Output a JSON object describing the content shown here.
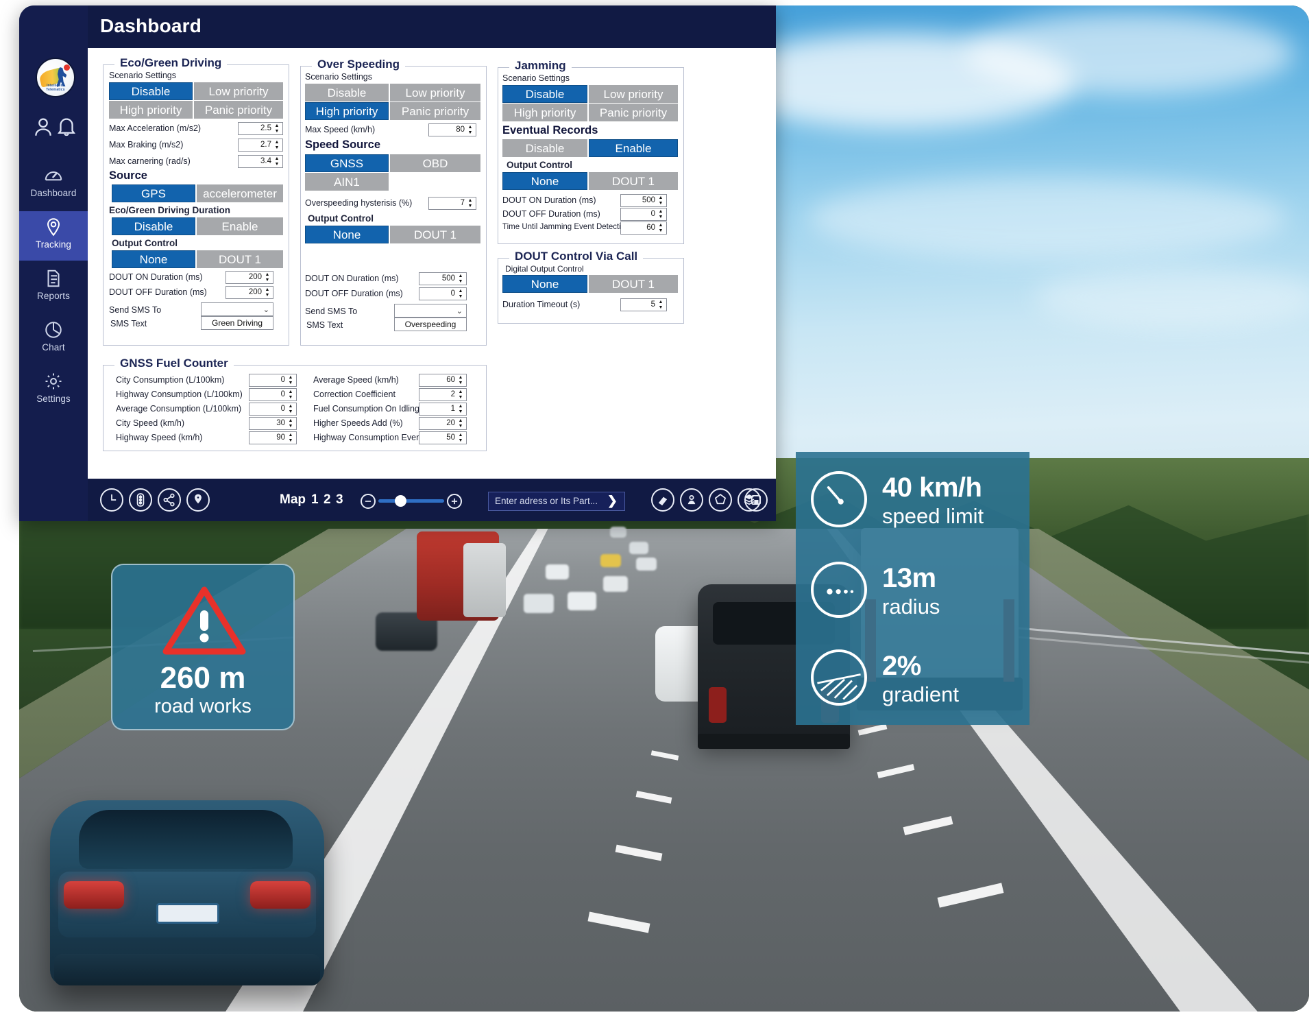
{
  "window": {
    "title": "Dashboard"
  },
  "sidebar": {
    "logo_text": "Intelligent Telematics",
    "top_icons": [
      {
        "name": "user-icon",
        "glyph": "user"
      },
      {
        "name": "bell-icon",
        "glyph": "bell"
      }
    ],
    "items": [
      {
        "label": "Dashboard",
        "icon": "gauge-icon",
        "active": false
      },
      {
        "label": "Tracking",
        "icon": "map-pin-icon",
        "active": true
      },
      {
        "label": "Reports",
        "icon": "document-icon",
        "active": false
      },
      {
        "label": "Chart",
        "icon": "pie-chart-icon",
        "active": false
      },
      {
        "label": "Settings",
        "icon": "gear-icon",
        "active": false
      }
    ]
  },
  "eco": {
    "legend": "Eco/Green Driving",
    "scenario_label": "Scenario Settings",
    "scenario_options": [
      "Disable",
      "Low priority",
      "High priority",
      "Panic priority"
    ],
    "scenario_selected": "Disable",
    "fields": [
      {
        "label": "Max Acceleration (m/s2)",
        "value": "2.5"
      },
      {
        "label": "Max Braking (m/s2)",
        "value": "2.7"
      },
      {
        "label": "Max carnering (rad/s)",
        "value": "3.4"
      }
    ],
    "source_label": "Source",
    "source_options": [
      "GPS",
      "accelerometer"
    ],
    "source_selected": "GPS",
    "duration_label": "Eco/Green Driving Duration",
    "duration_options": [
      "Disable",
      "Enable"
    ],
    "duration_selected": "Disable",
    "output_label": "Output Control",
    "output_options": [
      "None",
      "DOUT 1"
    ],
    "output_selected": "None",
    "dout_fields": [
      {
        "label": "DOUT ON Duration (ms)",
        "value": "200"
      },
      {
        "label": "DOUT OFF Duration (ms)",
        "value": "200"
      }
    ],
    "sms_to_label": "Send SMS To",
    "sms_to_value": "",
    "sms_text_label": "SMS Text",
    "sms_text_value": "Green Driving"
  },
  "overspeeding": {
    "legend": "Over Speeding",
    "scenario_label": "Scenario Settings",
    "scenario_options": [
      "Disable",
      "Low priority",
      "High priority",
      "Panic priority"
    ],
    "scenario_selected": "High priority",
    "max_speed_label": "Max Speed (km/h)",
    "max_speed_value": "80",
    "speed_source_label": "Speed Source",
    "speed_source_options": [
      "GNSS",
      "OBD",
      "AIN1"
    ],
    "speed_source_selected": "GNSS",
    "hysteresis_label": "Overspeeding hysterisis (%)",
    "hysteresis_value": "7",
    "output_label": "Output Control",
    "output_options": [
      "None",
      "DOUT 1"
    ],
    "output_selected": "None",
    "dout_fields": [
      {
        "label": "DOUT ON Duration (ms)",
        "value": "500"
      },
      {
        "label": "DOUT OFF Duration (ms)",
        "value": "0"
      }
    ],
    "sms_to_label": "Send SMS To",
    "sms_to_value": "",
    "sms_text_label": "SMS Text",
    "sms_text_value": "Overspeeding"
  },
  "jamming": {
    "legend": "Jamming",
    "scenario_label": "Scenario Settings",
    "scenario_options": [
      "Disable",
      "Low priority",
      "High priority",
      "Panic priority"
    ],
    "scenario_selected": "Disable",
    "eventual_label": "Eventual Records",
    "eventual_options": [
      "Disable",
      "Enable"
    ],
    "eventual_selected": "Enable",
    "output_label": "Output Control",
    "output_options": [
      "None",
      "DOUT 1"
    ],
    "output_selected": "None",
    "fields": [
      {
        "label": "DOUT ON Duration (ms)",
        "value": "500"
      },
      {
        "label": "DOUT OFF Duration (ms)",
        "value": "0"
      },
      {
        "label": "Time Until Jamming Event Detection (S)",
        "value": "60"
      }
    ]
  },
  "dout_call": {
    "legend": "DOUT Control Via Call",
    "digital_output_label": "Digital Output Control",
    "options": [
      "None",
      "DOUT 1"
    ],
    "selected": "None",
    "timeout_label": "Duration Timeout (s)",
    "timeout_value": "5"
  },
  "fuel": {
    "legend": "GNSS Fuel Counter",
    "left": [
      {
        "label": "City Consumption (L/100km)",
        "value": "0"
      },
      {
        "label": "Highway Consumption (L/100km)",
        "value": "0"
      },
      {
        "label": "Average Consumption (L/100km)",
        "value": "0"
      },
      {
        "label": "City Speed (km/h)",
        "value": "30"
      },
      {
        "label": "Highway Speed (km/h)",
        "value": "90"
      }
    ],
    "right": [
      {
        "label": "Average Speed (km/h)",
        "value": "60"
      },
      {
        "label": "Correction Coefficient",
        "value": "2"
      },
      {
        "label": "Fuel Consumption On Idling (l/h)",
        "value": "1"
      },
      {
        "label": "Higher Speeds Add (%)",
        "value": "20"
      },
      {
        "label": "Highway Consumption Every (km/h)",
        "value": "50"
      }
    ]
  },
  "toolbar": {
    "left_icons": [
      "clock-icon",
      "traffic-light-icon",
      "share-icon",
      "location-pin-icon"
    ],
    "map_label": "Map",
    "map_layers": [
      "1",
      "2",
      "3"
    ],
    "zoom_out_label": "−",
    "zoom_in_label": "+",
    "search_placeholder": "Enter adress or Its Part...",
    "search_value": "",
    "search_go": "❯",
    "right_icons": [
      "eraser-icon",
      "marker-icon",
      "polygon-icon",
      "layers-icon",
      "save-icon"
    ]
  },
  "cards": {
    "roadworks": {
      "icon": "warning-triangle-icon",
      "value": "260 m",
      "label": "road works",
      "accent": "#e8312a",
      "bg": "#2b7291"
    },
    "telemetry": {
      "bg": "#2b7291",
      "rows": [
        {
          "icon": "speedometer-icon",
          "value": "40 km/h",
          "label": "speed limit"
        },
        {
          "icon": "radius-dots-icon",
          "value": "13m",
          "label": "radius"
        },
        {
          "icon": "gradient-slope-icon",
          "value": "2%",
          "label": "gradient"
        }
      ]
    }
  },
  "colors": {
    "accent_blue": "#1263ad",
    "inactive_gray": "#a6a8ab",
    "nav_active": "#3a4aa8",
    "titlebar": "#111a44",
    "card_teal": "#2b7291",
    "warning_red": "#e8312a"
  }
}
